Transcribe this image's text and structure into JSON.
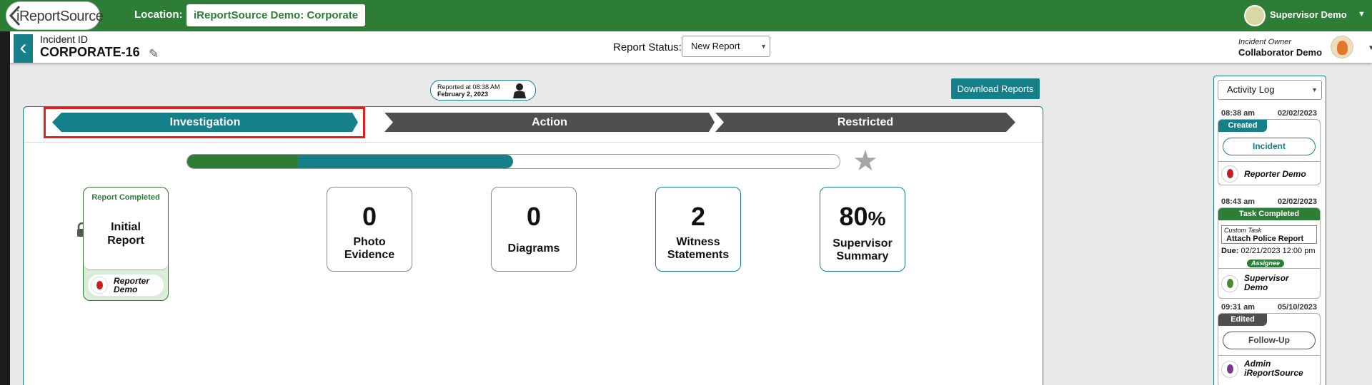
{
  "app": {
    "logo_text": "iReportSource"
  },
  "topbar": {
    "location_label": "Location:",
    "location_value": "iReportSource Demo: Corporate",
    "user_name": "Supervisor Demo",
    "color": "#2e7d37"
  },
  "incident": {
    "id_label": "Incident ID",
    "id_value": "CORPORATE-16",
    "status_label": "Report Status:",
    "status_value": "New Report",
    "owner_label": "Incident Owner",
    "owner_name": "Collaborator Demo"
  },
  "reported": {
    "time": "Reported at 08:38 AM",
    "date": "February 2, 2023"
  },
  "download_label": "Download Reports",
  "tabs": [
    {
      "label": "Investigation",
      "active": true
    },
    {
      "label": "Action",
      "active": false
    },
    {
      "label": "Restricted",
      "active": false
    }
  ],
  "progress": {
    "green_fraction": 0.17,
    "teal_fraction": 0.5
  },
  "initial_report": {
    "status": "Report Completed",
    "title_line1": "Initial",
    "title_line2": "Report",
    "reporter_line1": "Reporter",
    "reporter_line2": "Demo"
  },
  "stats": [
    {
      "value": "0",
      "label_line1": "Photo",
      "label_line2": "Evidence"
    },
    {
      "value": "0",
      "label_line1": "Diagrams",
      "label_line2": ""
    },
    {
      "value": "2",
      "label_line1": "Witness",
      "label_line2": "Statements"
    },
    {
      "value": "80",
      "unit": "%",
      "label_line1": "Supervisor",
      "label_line2": "Summary"
    }
  ],
  "activity_log": {
    "select_value": "Activity Log",
    "entries": [
      {
        "time": "08:38 am",
        "date": "02/02/2023",
        "badge": "Created",
        "pill": "Incident",
        "user_line1": "Reporter Demo",
        "user_line2": ""
      },
      {
        "time": "08:43 am",
        "date": "02/02/2023",
        "badge": "Task Completed",
        "task_label": "Custom Task",
        "task_title": "Attach Police Report",
        "due_label": "Due:",
        "due_value": "02/21/2023 12:00 pm",
        "assignee_label": "Assignee",
        "user_line1": "Supervisor",
        "user_line2": "Demo"
      },
      {
        "time": "09:31 am",
        "date": "05/10/2023",
        "badge": "Edited",
        "pill": "Follow-Up",
        "user_line1": "Admin",
        "user_line2": "iReportSource"
      }
    ]
  },
  "colors": {
    "teal": "#13808a",
    "green": "#2e7d37",
    "dark_tab": "#4f4f4f",
    "highlight": "#e02020"
  }
}
